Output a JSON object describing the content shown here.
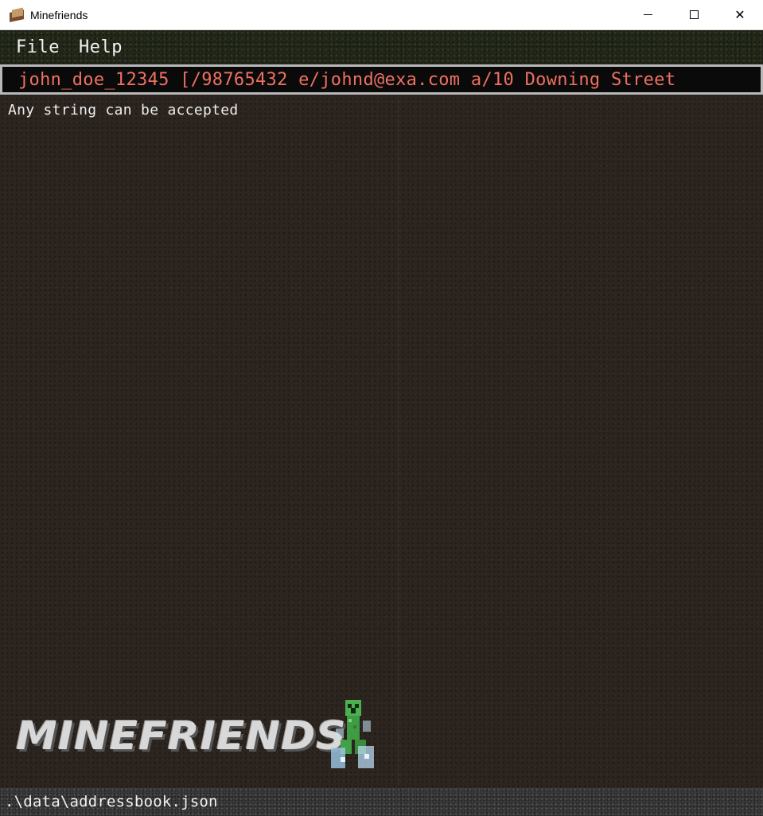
{
  "window": {
    "title": "Minefriends",
    "controls": {
      "minimize": "minimize",
      "maximize": "maximize",
      "close": "✕"
    }
  },
  "menu": {
    "items": [
      {
        "label": "File"
      },
      {
        "label": "Help"
      }
    ]
  },
  "command": {
    "value": "john_doe_12345 [/98765432 e/johnd@exa.com a/10 Downing Street"
  },
  "result": {
    "message": "Any string can be accepted"
  },
  "branding": {
    "logo_text": "MINEFRIENDS"
  },
  "status": {
    "path": ".\\data\\addressbook.json"
  },
  "colors": {
    "command_text": "#ee7061",
    "command_border": "#b8b8b8",
    "background": "#2b241f"
  }
}
